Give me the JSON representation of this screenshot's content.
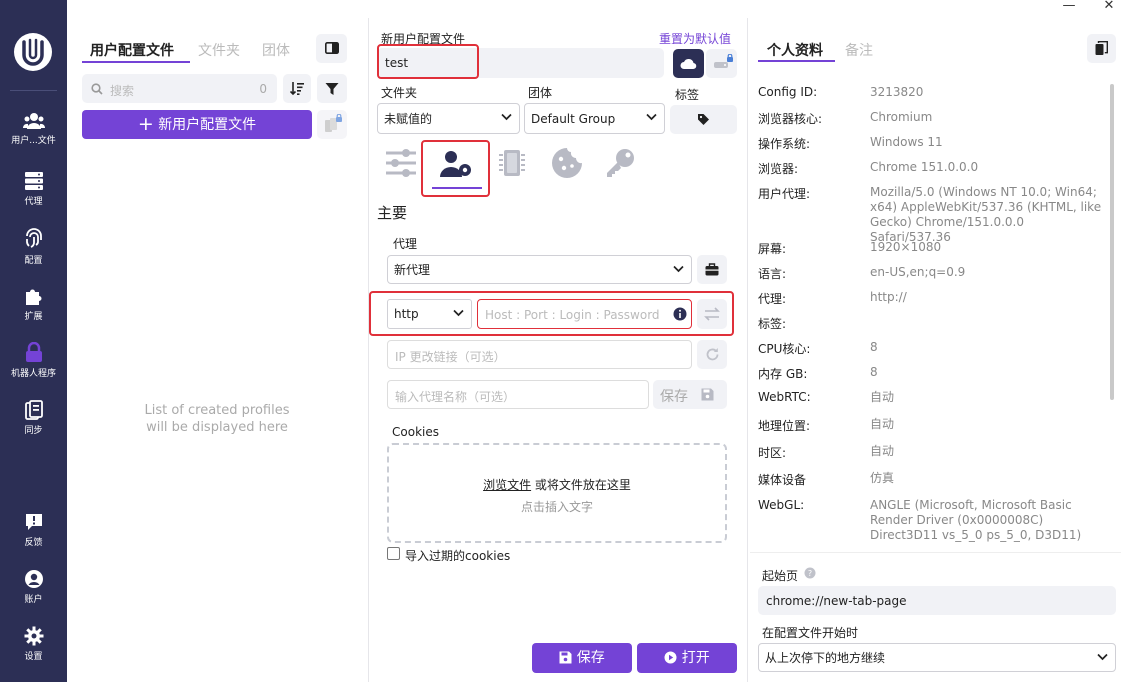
{
  "window": {
    "minimize": "—",
    "close": "✕"
  },
  "sidebar": {
    "items": [
      {
        "label": "用户...文件",
        "icon": "users-gear-icon"
      },
      {
        "label": "代理",
        "icon": "server-icon"
      },
      {
        "label": "配置",
        "icon": "fingerprint-icon"
      },
      {
        "label": "扩展",
        "icon": "puzzle-icon"
      },
      {
        "label": "机器人程序",
        "icon": "lock-icon"
      },
      {
        "label": "同步",
        "icon": "sync-icon"
      }
    ],
    "bottom": [
      {
        "label": "反馈",
        "icon": "feedback-icon"
      },
      {
        "label": "账户",
        "icon": "account-icon"
      },
      {
        "label": "设置",
        "icon": "gear-icon"
      }
    ]
  },
  "list_panel": {
    "tabs": [
      "用户配置文件",
      "文件夹",
      "团体"
    ],
    "search_placeholder": "搜索",
    "search_count": "0",
    "new_profile_label": "新用户配置文件",
    "empty_text_1": "List of created profiles",
    "empty_text_2": "will be displayed here"
  },
  "editor": {
    "name_label": "新用户配置文件",
    "reset_label": "重置为默认值",
    "name_value": "test",
    "folder_label": "文件夹",
    "folder_value": "未赋值的",
    "group_label": "团体",
    "group_value": "Default Group",
    "tags_label": "标签",
    "section_title": "主要",
    "proxy_label": "代理",
    "proxy_value": "新代理",
    "proxy_type": "http",
    "proxy_host_placeholder": "Host : Port : Login : Password",
    "ip_change_placeholder": "IP 更改链接（可选）",
    "proxy_name_placeholder": "输入代理名称（可选）",
    "save_small": "保存",
    "cookies_label": "Cookies",
    "browse_files": "浏览文件",
    "drop_text": " 或将文件放在这里",
    "paste_text": "点击插入文字",
    "import_expired": "导入过期的cookies",
    "save_label": "保存",
    "open_label": "打开"
  },
  "info_panel": {
    "tabs": [
      "个人资料",
      "备注"
    ],
    "rows": [
      {
        "key": "Config ID:",
        "value": "3213820"
      },
      {
        "key": "浏览器核心:",
        "value": "Chromium"
      },
      {
        "key": "操作系统:",
        "value": "Windows 11"
      },
      {
        "key": "浏览器:",
        "value": "Chrome 151.0.0.0"
      },
      {
        "key": "用户代理:",
        "value": "Mozilla/5.0 (Windows NT 10.0; Win64; x64) AppleWebKit/537.36 (KHTML, like Gecko) Chrome/151.0.0.0 Safari/537.36"
      },
      {
        "key": "屏幕:",
        "value": "1920×1080"
      },
      {
        "key": "语言:",
        "value": "en-US,en;q=0.9"
      },
      {
        "key": "代理:",
        "value": "http://"
      },
      {
        "key": "标签:",
        "value": ""
      },
      {
        "key": "CPU核心:",
        "value": "8"
      },
      {
        "key": "内存 GB:",
        "value": "8"
      },
      {
        "key": "WebRTC:",
        "value": "自动"
      },
      {
        "key": "地理位置:",
        "value": "自动"
      },
      {
        "key": "时区:",
        "value": "自动"
      },
      {
        "key": "媒体设备",
        "value": "仿真"
      },
      {
        "key": "WebGL:",
        "value": "ANGLE (Microsoft, Microsoft Basic Render Driver (0x0000008C) Direct3D11 vs_5_0 ps_5_0, D3D11)"
      }
    ],
    "start_page_label": "起始页",
    "start_page_value": "chrome://new-tab-page",
    "on_start_label": "在配置文件开始时",
    "on_start_value": "从上次停下的地方继续"
  },
  "colors": {
    "accent": "#7443d6",
    "sidebar": "#2c2f55",
    "highlight": "#e0303a"
  }
}
